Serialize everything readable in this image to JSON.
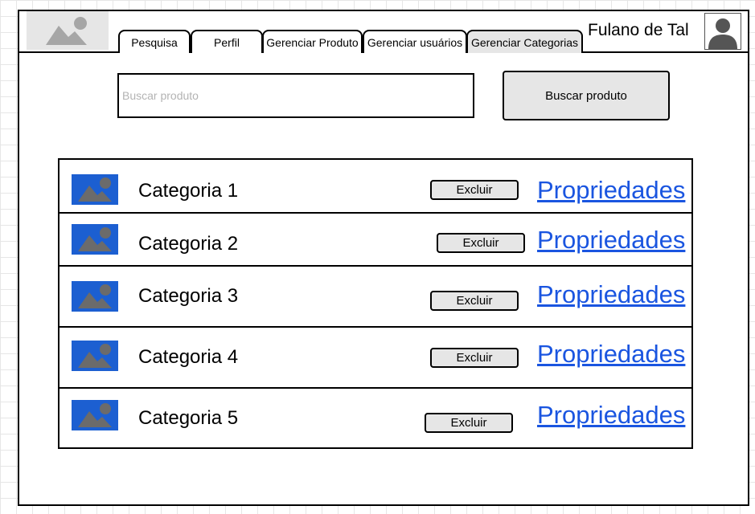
{
  "header": {
    "user_name": "Fulano de Tal",
    "tabs": [
      {
        "label": "Pesquisa"
      },
      {
        "label": "Perfil"
      },
      {
        "label": "Gerenciar Produto"
      },
      {
        "label": "Gerenciar usuários"
      },
      {
        "label": "Gerenciar Categorias",
        "active": true
      }
    ]
  },
  "search": {
    "placeholder": "Buscar produto",
    "value": "",
    "button_label": "Buscar produto"
  },
  "categories": [
    {
      "name": "Categoria 1",
      "delete_label": "Excluir",
      "properties_label": "Propriedades"
    },
    {
      "name": "Categoria 2",
      "delete_label": "Excluir",
      "properties_label": "Propriedades"
    },
    {
      "name": "Categoria 3",
      "delete_label": "Excluir",
      "properties_label": "Propriedades"
    },
    {
      "name": "Categoria 4",
      "delete_label": "Excluir",
      "properties_label": "Propriedades"
    },
    {
      "name": "Categoria 5",
      "delete_label": "Excluir",
      "properties_label": "Propriedades"
    }
  ],
  "colors": {
    "thumb_background": "#1c5fd1",
    "link": "#1a55e0",
    "active_tab": "#e6e6e6"
  }
}
